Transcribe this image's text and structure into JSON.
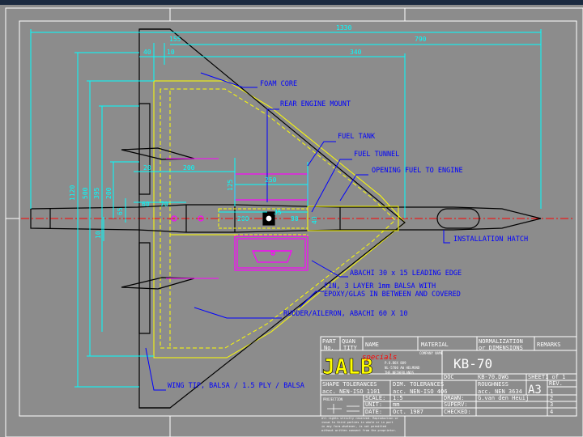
{
  "colors": {
    "background": "#8c8c8c",
    "titlebar": "#1b2a40",
    "dimension": "#00ffff",
    "annotation": "#0000ff",
    "outline": "#000000",
    "foam_core": "#ffff00",
    "fuel_tank": "#ff00ff",
    "centerline": "#ff0000",
    "frame": "#ffffff"
  },
  "dimensions": {
    "overall_length": "1330",
    "wing_root": "790",
    "d155": "155",
    "d40": "40",
    "d10": "10",
    "d340": "340",
    "d1120": "1120",
    "d500": "500",
    "d395": "395",
    "d200_v": "200",
    "d65": "65",
    "d10_left": "10",
    "d20": "20",
    "d200_h": "200",
    "d125": "125",
    "d250": "250",
    "d60": "60",
    "d70": "70",
    "d200_tunnel": "200",
    "d35": "35",
    "d90": "90",
    "d40_v": "40"
  },
  "callouts": {
    "foam_core": "FOAM CORE",
    "rear_engine_mount": "REAR ENGINE MOUNT",
    "fuel_tank": "FUEL TANK",
    "fuel_tunnel": "FUEL TUNNEL",
    "opening_fuel": "OPENING FUEL TO ENGINE",
    "installation_hatch": "INSTALLATION HATCH",
    "leading_edge": "ABACHI 30 x 15 LEADING EDGE",
    "fin_line1": "FIN, 3 LAYER 1mm BALSA WITH",
    "fin_line2": "EPOXY/GLAS IN BETWEEN AND COVERED",
    "rudder": "RUDDER/AILERON, ABACHI 60 X 10",
    "wing_tip": "WING TIP, BALSA / 1.5 PLY / BALSA"
  },
  "title_block": {
    "part_no_l1": "PART",
    "part_no_l2": "No.",
    "quantity_l1": "QUAN",
    "quantity_l2": "TITY",
    "name": "NAME",
    "material": "MATERIAL",
    "normalization_l1": "NORMALIZATION",
    "normalization_l2": "or DIMENSIONS",
    "remarks": "REMARKS",
    "logo": "JALB",
    "logo_script": "specials",
    "address_l1": "P.O.BOX 889",
    "address_l2": "NL-5700 AW HELMOND",
    "address_l3": "THE NETHERLANDS",
    "company_name_label": "COMPANY NAME",
    "drawing_title": "KB-70",
    "doc_label": "DOC",
    "doc_value": "KB-70.DWG",
    "sheet": "SHEET1 of 1",
    "shape_tol_l1": "SHAPE TOLERANCES",
    "shape_tol_l2": "acc. NEN-ISO 1101",
    "dim_tol_l1": "DIM. TOLERANCES",
    "dim_tol_l2": "acc. NEN-ISO 406",
    "roughness_l1": "ROUGHNESS",
    "roughness_l2": "acc. NEN 3634",
    "paper_size": "A3",
    "rev_label": "REV.",
    "rev_values": [
      "1",
      "2",
      "3",
      "4"
    ],
    "projection": "PROJECTION",
    "scale_label": "SCALE:",
    "scale_value": "1:5",
    "unit_label": "UNIT:",
    "unit_value": "mm",
    "date_label": "DATE:",
    "date_value": "Oct. 1987",
    "drawn_label": "DRAWN:",
    "drawn_value": "G.van den Heuij",
    "supervisor_label": "SUPERV:",
    "checked_label": "CHECKED:",
    "copyright_l1": "All rights strictly reserved. Reproduction or",
    "copyright_l2": "issue to third parties in whole or in part",
    "copyright_l3": "in any form whatever, is not permitted",
    "copyright_l4": "without written consent from the proprietor."
  }
}
